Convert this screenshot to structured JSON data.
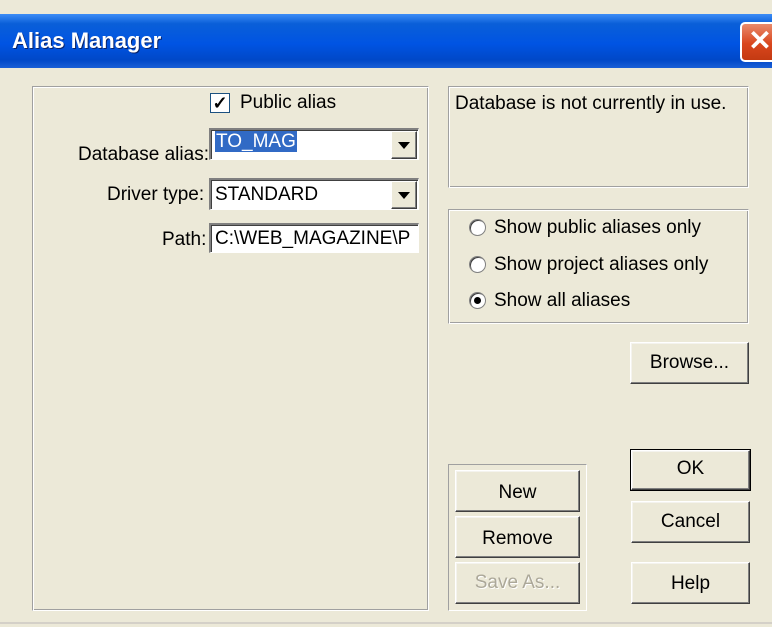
{
  "window": {
    "title": "Alias Manager",
    "close_glyph": "✕"
  },
  "form": {
    "public_alias": {
      "label": "Public alias",
      "checked": true,
      "check_glyph": "✓"
    },
    "database_alias": {
      "label": "Database alias:",
      "value": "TO_MAG"
    },
    "driver_type": {
      "label": "Driver type:",
      "value": "STANDARD"
    },
    "path": {
      "label": "Path:",
      "value": "C:\\WEB_MAGAZINE\\P"
    }
  },
  "status": {
    "text": "Database is not currently in use."
  },
  "filter": {
    "options": [
      {
        "label": "Show public aliases only",
        "selected": false
      },
      {
        "label": "Show project aliases only",
        "selected": false
      },
      {
        "label": "Show all aliases",
        "selected": true
      }
    ]
  },
  "buttons": {
    "browse": "Browse...",
    "new": "New",
    "remove": "Remove",
    "save_as": "Save As...",
    "ok": "OK",
    "cancel": "Cancel",
    "help": "Help"
  },
  "colors": {
    "titlebar": "#0054e3",
    "dialog_bg": "#ece9d8",
    "selection": "#316ac5",
    "close": "#d9461d"
  }
}
